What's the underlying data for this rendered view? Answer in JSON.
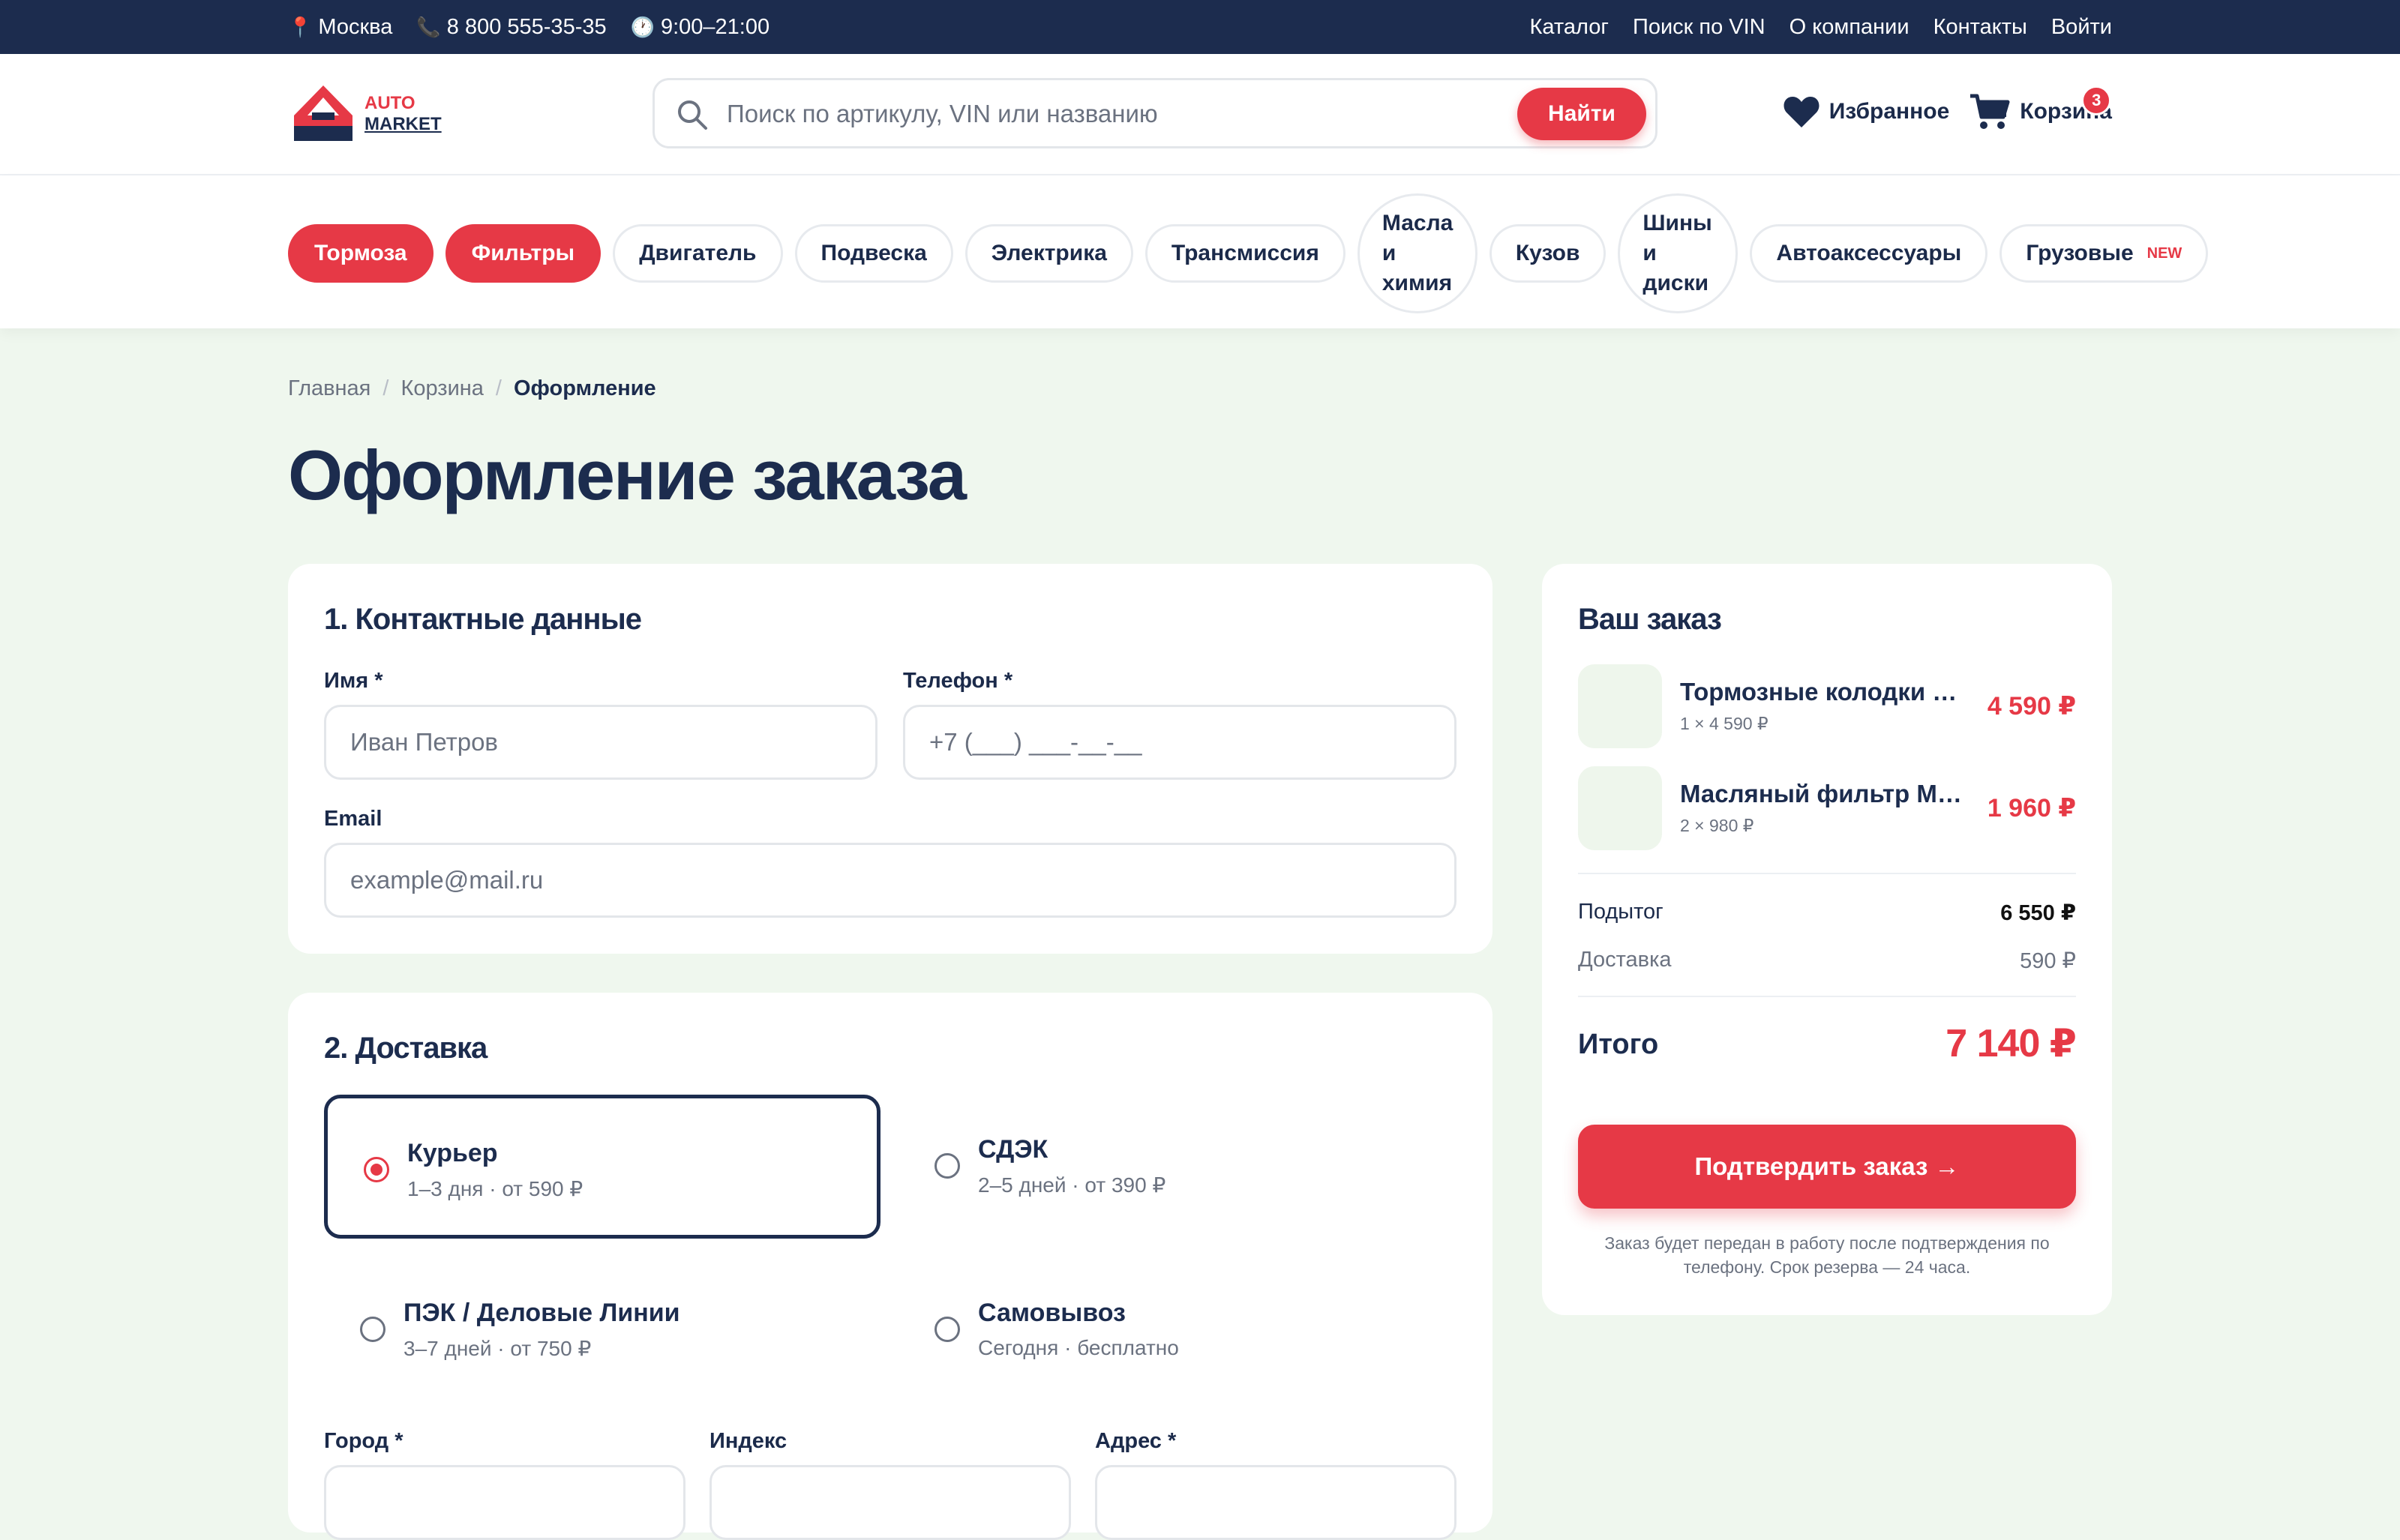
{
  "topbar": {
    "city": "Москва",
    "phone": "8 800 555-35-35",
    "hours": "9:00–21:00",
    "links": [
      "Каталог",
      "Поиск по VIN",
      "О компании",
      "Контакты",
      "Войти"
    ]
  },
  "logo": {
    "line1": "AUTO",
    "line2": "MARKET"
  },
  "search": {
    "placeholder": "Поиск по артикулу, VIN или названию",
    "button": "Найти"
  },
  "header": {
    "favorites": "Избранное",
    "cart": "Корзина",
    "cart_count": "3"
  },
  "categories": [
    {
      "label": "Тормоза",
      "active": true
    },
    {
      "label": "Фильтры",
      "active": true
    },
    {
      "label": "Двигатель"
    },
    {
      "label": "Подвеска"
    },
    {
      "label": "Электрика"
    },
    {
      "label": "Трансмиссия"
    },
    {
      "label": "Масла и химия"
    },
    {
      "label": "Кузов"
    },
    {
      "label": "Шины и диски"
    },
    {
      "label": "Автоаксессуары"
    },
    {
      "label": "Грузовые",
      "tag": "NEW"
    }
  ],
  "breadcrumb": {
    "home": "Главная",
    "cart": "Корзина",
    "current": "Оформление"
  },
  "page_title": "Оформление заказа",
  "contacts": {
    "title": "1. Контактные данные",
    "name_label": "Имя *",
    "name_placeholder": "Иван Петров",
    "phone_label": "Телефон *",
    "phone_placeholder": "+7 (___) ___-__-__",
    "email_label": "Email",
    "email_placeholder": "example@mail.ru"
  },
  "delivery": {
    "title": "2. Доставка",
    "options": [
      {
        "name": "Курьер",
        "sub": "1–3 дня · от 590 ₽",
        "selected": true
      },
      {
        "name": "СДЭК",
        "sub": "2–5 дней · от 390 ₽"
      },
      {
        "name": "ПЭК / Деловые Линии",
        "sub": "3–7 дней · от 750 ₽"
      },
      {
        "name": "Самовывоз",
        "sub": "Сегодня · бесплатно"
      }
    ],
    "city_label": "Город *",
    "index_label": "Индекс",
    "address_label": "Адрес *"
  },
  "summary": {
    "title": "Ваш заказ",
    "items": [
      {
        "name": "Тормозные колодки Brembo",
        "qty": "1 × 4 590 ₽",
        "price": "4 590 ₽"
      },
      {
        "name": "Масляный фильтр Mann",
        "qty": "2 × 980 ₽",
        "price": "1 960 ₽"
      }
    ],
    "subtotal_label": "Подытог",
    "subtotal": "6 550 ₽",
    "delivery_label": "Доставка",
    "delivery": "590 ₽",
    "total_label": "Итого",
    "total": "7 140 ₽",
    "confirm": "Подтвердить заказ →",
    "note": "Заказ будет передан в работу после подтверждения по телефону. Срок резерва — 24 часа."
  },
  "colors": {
    "primary": "#1c2c4e",
    "accent": "#e63946",
    "bg": "#eff7ee"
  }
}
